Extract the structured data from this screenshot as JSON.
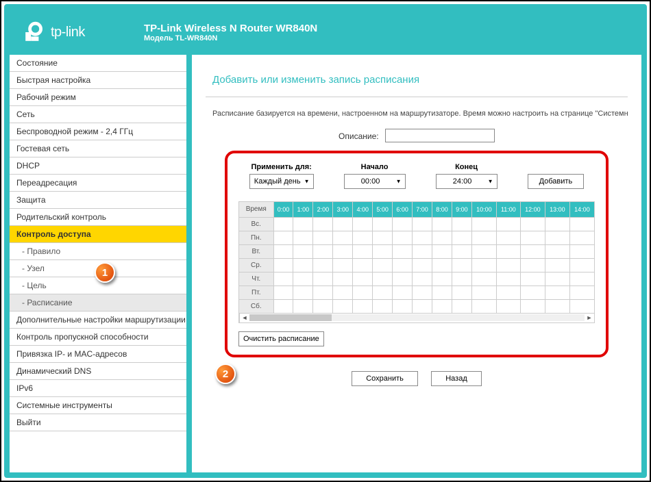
{
  "header": {
    "brand": "tp-link",
    "title": "TP-Link Wireless N Router WR840N",
    "subtitle": "Модель TL-WR840N"
  },
  "menu": {
    "items": [
      {
        "label": "Состояние",
        "cls": "top-level"
      },
      {
        "label": "Быстрая настройка",
        "cls": "top-level"
      },
      {
        "label": "Рабочий режим",
        "cls": "top-level"
      },
      {
        "label": "Сеть",
        "cls": "top-level"
      },
      {
        "label": "Беспроводной режим - 2,4 ГГц",
        "cls": "top-level"
      },
      {
        "label": "Гостевая сеть",
        "cls": "top-level"
      },
      {
        "label": "DHCP",
        "cls": "top-level"
      },
      {
        "label": "Переадресация",
        "cls": "top-level"
      },
      {
        "label": "Защита",
        "cls": "top-level"
      },
      {
        "label": "Родительский контроль",
        "cls": "top-level"
      },
      {
        "label": "Контроль доступа",
        "cls": "top-level active-parent"
      },
      {
        "label": "- Правило",
        "cls": "sub-level"
      },
      {
        "label": "- Узел",
        "cls": "sub-level"
      },
      {
        "label": "- Цель",
        "cls": "sub-level"
      },
      {
        "label": "- Расписание",
        "cls": "sub-level active-sub"
      },
      {
        "label": "Дополнительные настройки маршрутизации",
        "cls": "top-level"
      },
      {
        "label": "Контроль пропускной способности",
        "cls": "top-level"
      },
      {
        "label": "Привязка IP- и MAC-адресов",
        "cls": "top-level"
      },
      {
        "label": "Динамический DNS",
        "cls": "top-level"
      },
      {
        "label": "IPv6",
        "cls": "top-level"
      },
      {
        "label": "Системные инструменты",
        "cls": "top-level"
      },
      {
        "label": "Выйти",
        "cls": "top-level"
      }
    ]
  },
  "content": {
    "page_title": "Добавить или изменить запись расписания",
    "info_text": "Расписание базируется на времени, настроенном на маршрутизаторе. Время можно настроить на странице \"Системные ин",
    "desc_label": "Описание:",
    "apply_label": "Применить для:",
    "apply_value": "Каждый день",
    "start_label": "Начало",
    "start_value": "00:00",
    "end_label": "Конец",
    "end_value": "24:00",
    "add_btn": "Добавить",
    "clear_btn": "Очистить расписание",
    "save_btn": "Сохранить",
    "back_btn": "Назад"
  },
  "schedule": {
    "corner_label": "Время",
    "hours": [
      "0:00",
      "1:00",
      "2:00",
      "3:00",
      "4:00",
      "5:00",
      "6:00",
      "7:00",
      "8:00",
      "9:00",
      "10:00",
      "11:00",
      "12:00",
      "13:00",
      "14:00"
    ],
    "days": [
      "Вс.",
      "Пн.",
      "Вт.",
      "Ср.",
      "Чт.",
      "Пт.",
      "Сб."
    ]
  },
  "annotations": {
    "one": "1",
    "two": "2"
  }
}
